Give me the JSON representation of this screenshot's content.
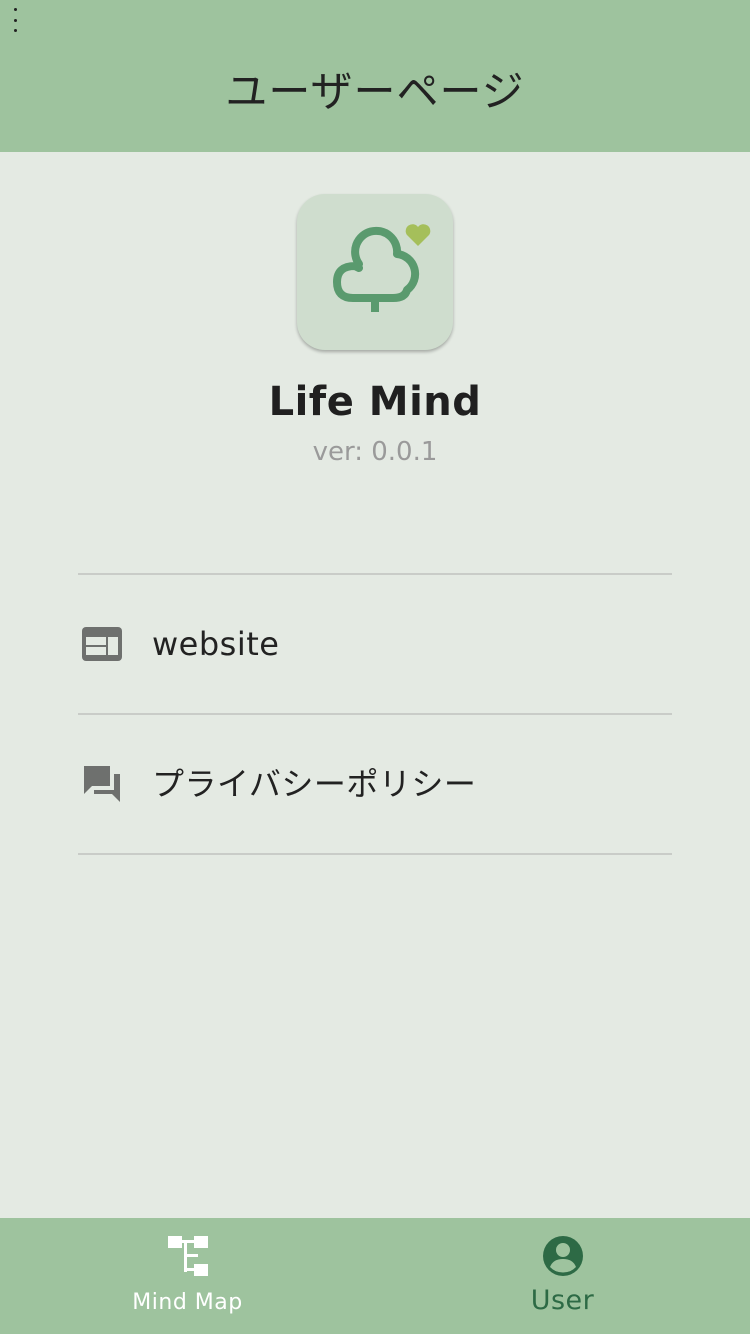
{
  "header": {
    "title": "ユーザーページ"
  },
  "app": {
    "name": "Life Mind",
    "version": "ver: 0.0.1",
    "icon": "tree-heart-logo"
  },
  "menu": {
    "items": [
      {
        "icon": "web-icon",
        "label": "website"
      },
      {
        "icon": "forum-icon",
        "label": "プライバシーポリシー"
      }
    ]
  },
  "bottom_nav": {
    "items": [
      {
        "icon": "mind-map-icon",
        "label": "Mind Map",
        "active": false
      },
      {
        "icon": "account-circle-icon",
        "label": "User",
        "active": true
      }
    ]
  },
  "colors": {
    "header_bg": "#9ec39e",
    "page_bg": "#e4eae3",
    "icon_tile_bg": "#cfddce",
    "tree_green": "#5a9a6e",
    "heart_green": "#a5bf5a",
    "active_nav": "#2d6a45",
    "inactive_nav": "#ffffff",
    "menu_icon_gray": "#6e706e"
  }
}
